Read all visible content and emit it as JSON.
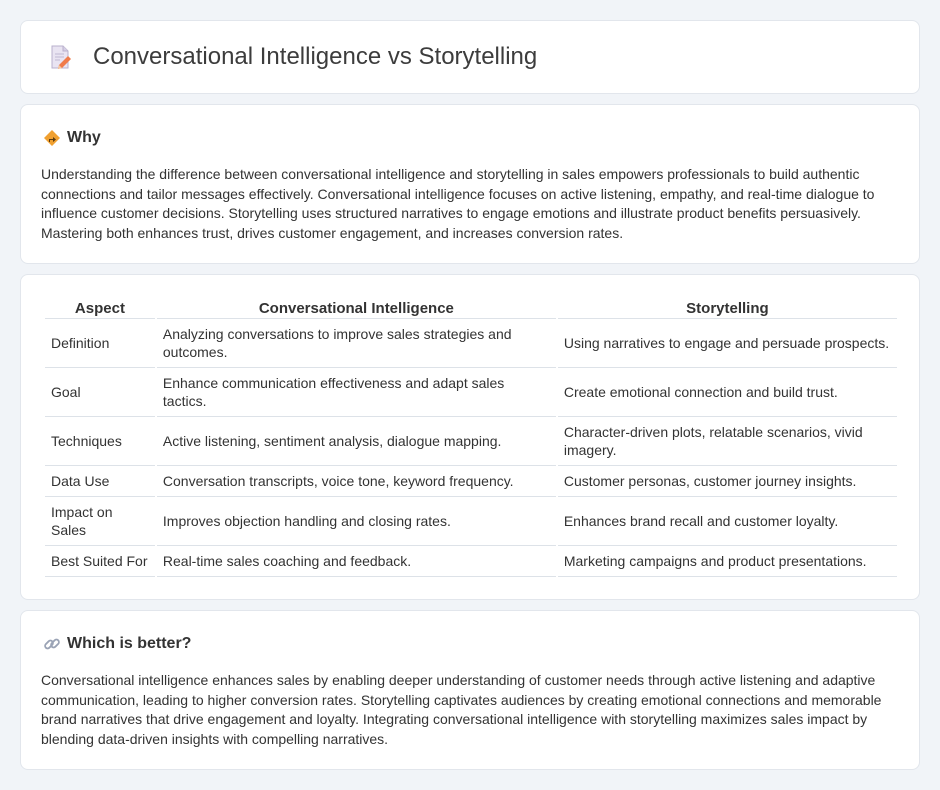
{
  "header": {
    "title": "Conversational Intelligence vs Storytelling",
    "icon": "document-pencil-icon"
  },
  "why": {
    "icon": "diamond-sign-icon",
    "title": "Why",
    "body": "Understanding the difference between conversational intelligence and storytelling in sales empowers professionals to build authentic connections and tailor messages effectively. Conversational intelligence focuses on active listening, empathy, and real-time dialogue to influence customer decisions. Storytelling uses structured narratives to engage emotions and illustrate product benefits persuasively. Mastering both enhances trust, drives customer engagement, and increases conversion rates."
  },
  "table": {
    "headers": [
      "Aspect",
      "Conversational Intelligence",
      "Storytelling"
    ],
    "rows": [
      [
        "Definition",
        "Analyzing conversations to improve sales strategies and outcomes.",
        "Using narratives to engage and persuade prospects."
      ],
      [
        "Goal",
        "Enhance communication effectiveness and adapt sales tactics.",
        "Create emotional connection and build trust."
      ],
      [
        "Techniques",
        "Active listening, sentiment analysis, dialogue mapping.",
        "Character-driven plots, relatable scenarios, vivid imagery."
      ],
      [
        "Data Use",
        "Conversation transcripts, voice tone, keyword frequency.",
        "Customer personas, customer journey insights."
      ],
      [
        "Impact on Sales",
        "Improves objection handling and closing rates.",
        "Enhances brand recall and customer loyalty."
      ],
      [
        "Best Suited For",
        "Real-time sales coaching and feedback.",
        "Marketing campaigns and product presentations."
      ]
    ]
  },
  "better": {
    "icon": "link-icon",
    "title": "Which is better?",
    "body": "Conversational intelligence enhances sales by enabling deeper understanding of customer needs through active listening and adaptive communication, leading to higher conversion rates. Storytelling captivates audiences by creating emotional connections and memorable brand narratives that drive engagement and loyalty. Integrating conversational intelligence with storytelling maximizes sales impact by blending data-driven insights with compelling narratives."
  },
  "colors": {
    "background": "#f1f4f8",
    "card": "#ffffff",
    "border": "#e2e6ec",
    "accent_orange": "#f0a030"
  }
}
